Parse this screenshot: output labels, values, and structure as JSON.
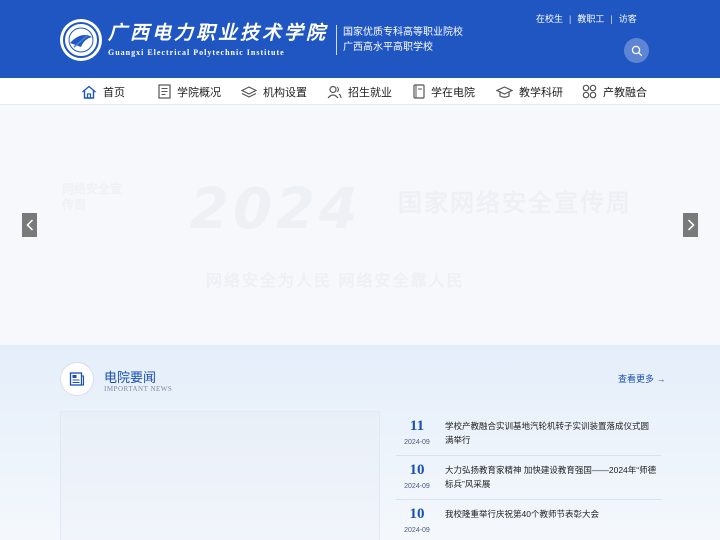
{
  "header": {
    "logo_cn": "广西电力职业技术学院",
    "logo_en": "Guangxi Electrical Polytechnic Institute",
    "slogans": [
      "国家优质专科高等职业院校",
      "广西高水平高职学校"
    ],
    "top_links": [
      "在校生",
      "教职工",
      "访客"
    ],
    "search_icon": "search-icon",
    "colors": {
      "primary": "#1f56c2",
      "accent_text": "#1a4fb4"
    }
  },
  "nav": {
    "items": [
      {
        "label": "首页",
        "icon": "home-icon"
      },
      {
        "label": "学院概况",
        "icon": "document-icon"
      },
      {
        "label": "机构设置",
        "icon": "layers-icon"
      },
      {
        "label": "招生就业",
        "icon": "users-icon"
      },
      {
        "label": "学在电院",
        "icon": "book-icon"
      },
      {
        "label": "教学科研",
        "icon": "graduation-cap-icon"
      },
      {
        "label": "产教融合",
        "icon": "grid-icon"
      }
    ]
  },
  "banner": {
    "year": "2024",
    "title": "国家网络安全宣传周",
    "subtitle": "网络安全为人民 网络安全靠人民",
    "side_text": "网络安全宣传周",
    "prev_icon": "chevron-left-icon",
    "next_icon": "chevron-right-icon"
  },
  "news": {
    "title": "电院要闻",
    "subtitle": "IMPORTANT NEWS",
    "more": "查看更多 →",
    "icon": "newspaper-icon",
    "items": [
      {
        "day": "11",
        "month": "2024-09",
        "text": "学校产教融合实训基地汽轮机转子实训装置落成仪式圆满举行"
      },
      {
        "day": "10",
        "month": "2024-09",
        "text": "大力弘扬教育家精神 加快建设教育强国——2024年“师德标兵”风采展"
      },
      {
        "day": "10",
        "month": "2024-09",
        "text": "我校隆重举行庆祝第40个教师节表彰大会"
      }
    ]
  }
}
